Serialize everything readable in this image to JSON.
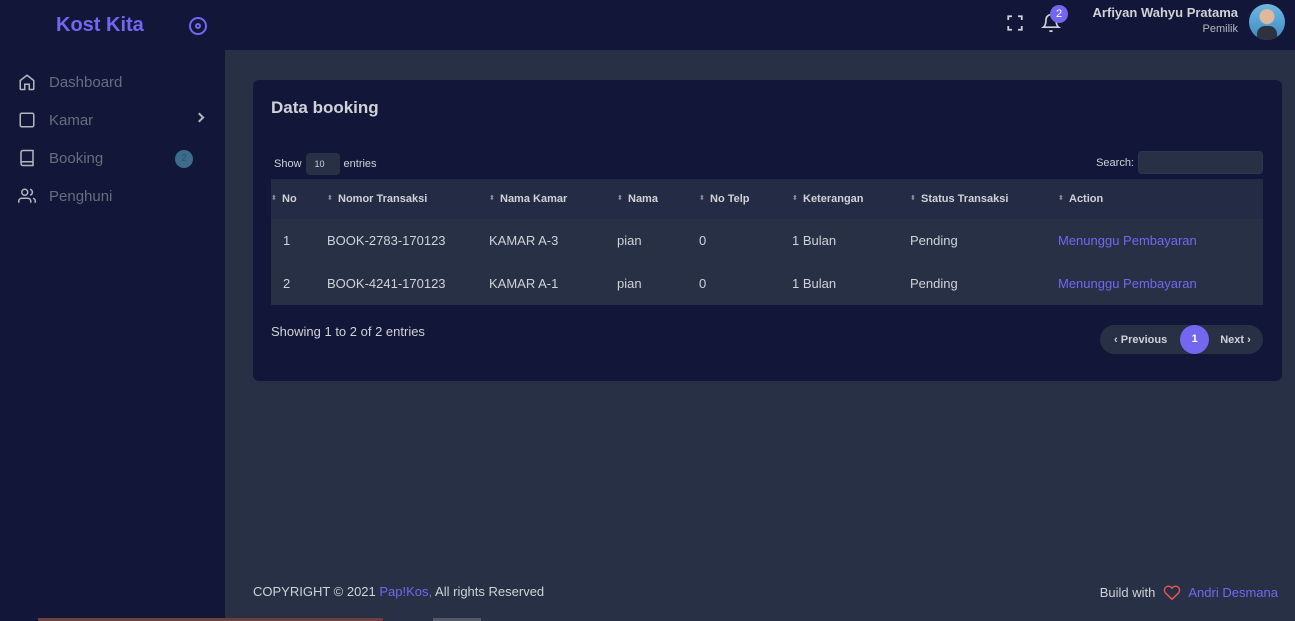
{
  "sidebar": {
    "brand": "Kost Kita",
    "items": [
      {
        "label": "Dashboard",
        "icon": "home-icon"
      },
      {
        "label": "Kamar",
        "icon": "square-icon"
      },
      {
        "label": "Booking",
        "icon": "book-icon",
        "badge": "2"
      },
      {
        "label": "Penghuni",
        "icon": "users-icon"
      }
    ]
  },
  "header": {
    "notification_count": "2",
    "user_name": "Arfiyan Wahyu Pratama",
    "user_role": "Pemilik"
  },
  "card": {
    "title": "Data booking",
    "show_label": "Show",
    "entries_value": "10",
    "entries_label": "entries",
    "search_label": "Search:",
    "search_value": "",
    "columns": [
      "No",
      "Nomor Transaksi",
      "Nama Kamar",
      "Nama",
      "No Telp",
      "Keterangan",
      "Status Transaksi",
      "Action"
    ],
    "rows": [
      [
        "1",
        "BOOK-2783-170123",
        "KAMAR A-3",
        "pian",
        "0",
        "1 Bulan",
        "Pending",
        "Menunggu Pembayaran"
      ],
      [
        "2",
        "BOOK-4241-170123",
        "KAMAR A-1",
        "pian",
        "0",
        "1 Bulan",
        "Pending",
        "Menunggu Pembayaran"
      ]
    ],
    "info": "Showing 1 to 2 of 2 entries",
    "pagination": {
      "previous": "Previous",
      "current": "1",
      "next": "Next"
    }
  },
  "footer": {
    "copyright_prefix": "COPYRIGHT © 2021 ",
    "brand_link": "Pap!Kos,",
    "copyright_suffix": " All rights Reserved",
    "build_with": "Build with",
    "author": "Andri Desmana"
  },
  "colors": {
    "accent": "#7367f0",
    "sidebar_bg": "#121739",
    "page_bg": "#283046"
  }
}
